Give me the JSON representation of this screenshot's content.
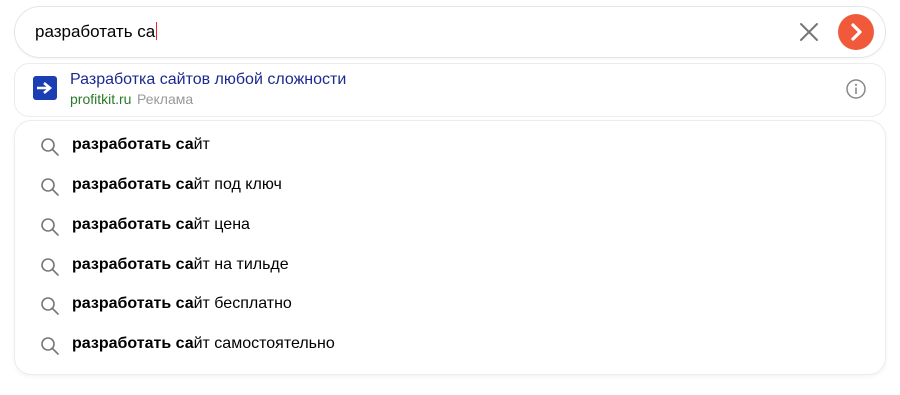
{
  "search": {
    "value": "разработать са"
  },
  "ad": {
    "title": "Разработка сайтов любой сложности",
    "url": "profitkit.ru",
    "label": "Реклама"
  },
  "suggestions": [
    {
      "bold": "разработать са",
      "rest": "йт"
    },
    {
      "bold": "разработать са",
      "rest": "йт под ключ"
    },
    {
      "bold": "разработать са",
      "rest": "йт цена"
    },
    {
      "bold": "разработать са",
      "rest": "йт на тильде"
    },
    {
      "bold": "разработать са",
      "rest": "йт бесплатно"
    },
    {
      "bold": "разработать са",
      "rest": "йт самостоятельно"
    }
  ],
  "icons": {
    "clear": "close-icon",
    "go": "arrow-right-icon",
    "info": "info-icon",
    "suggest": "search-icon"
  },
  "colors": {
    "accent": "#f05a3a",
    "ad_title": "#1a2a90",
    "ad_url": "#2a7a2a",
    "caret": "#e52b2b"
  }
}
